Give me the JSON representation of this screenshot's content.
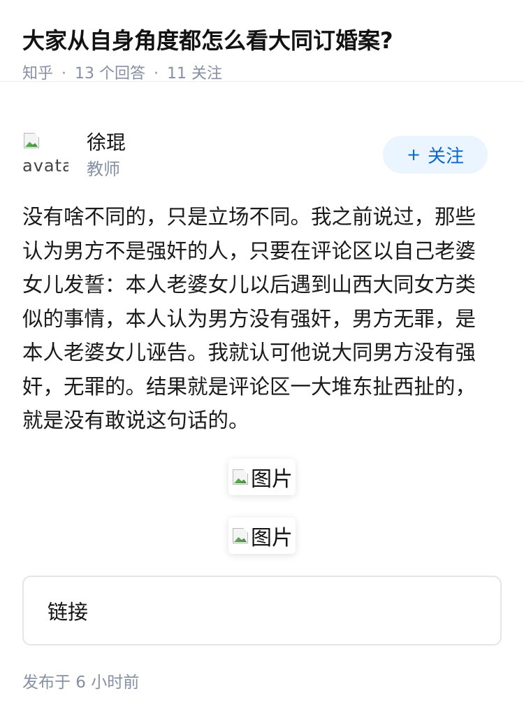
{
  "question": {
    "title": "大家从自身角度都怎么看大同订婚案?",
    "source": "知乎",
    "separator": "·",
    "answers_count": "13 个回答",
    "followers_count": "11 关注"
  },
  "author": {
    "avatar_alt": "avatar",
    "name": "徐琨",
    "role": "教师",
    "follow_plus": "+",
    "follow_label": "关注"
  },
  "answer": {
    "text": "没有啥不同的，只是立场不同。我之前说过，那些认为男方不是强奸的人，只要在评论区以自己老婆女儿发誓：本人老婆女儿以后遇到山西大同女方类似的事情，本人认为男方没有强奸，男方无罪，是本人老婆女儿诬告。我就认可他说大同男方没有强奸，无罪的。结果就是评论区一大堆东扯西扯的，就是没有敢说这句话的。",
    "images": [
      {
        "alt": "图片"
      },
      {
        "alt": "图片"
      }
    ],
    "link_label": "链接",
    "published": "发布于 6 小时前"
  },
  "colors": {
    "meta_gray": "#8590a6",
    "follow_bg": "#ebf5ff",
    "follow_text": "#0a66d1",
    "text_primary": "#121212"
  },
  "icons": {
    "broken_image": "broken-image-icon",
    "plus": "plus-icon"
  }
}
